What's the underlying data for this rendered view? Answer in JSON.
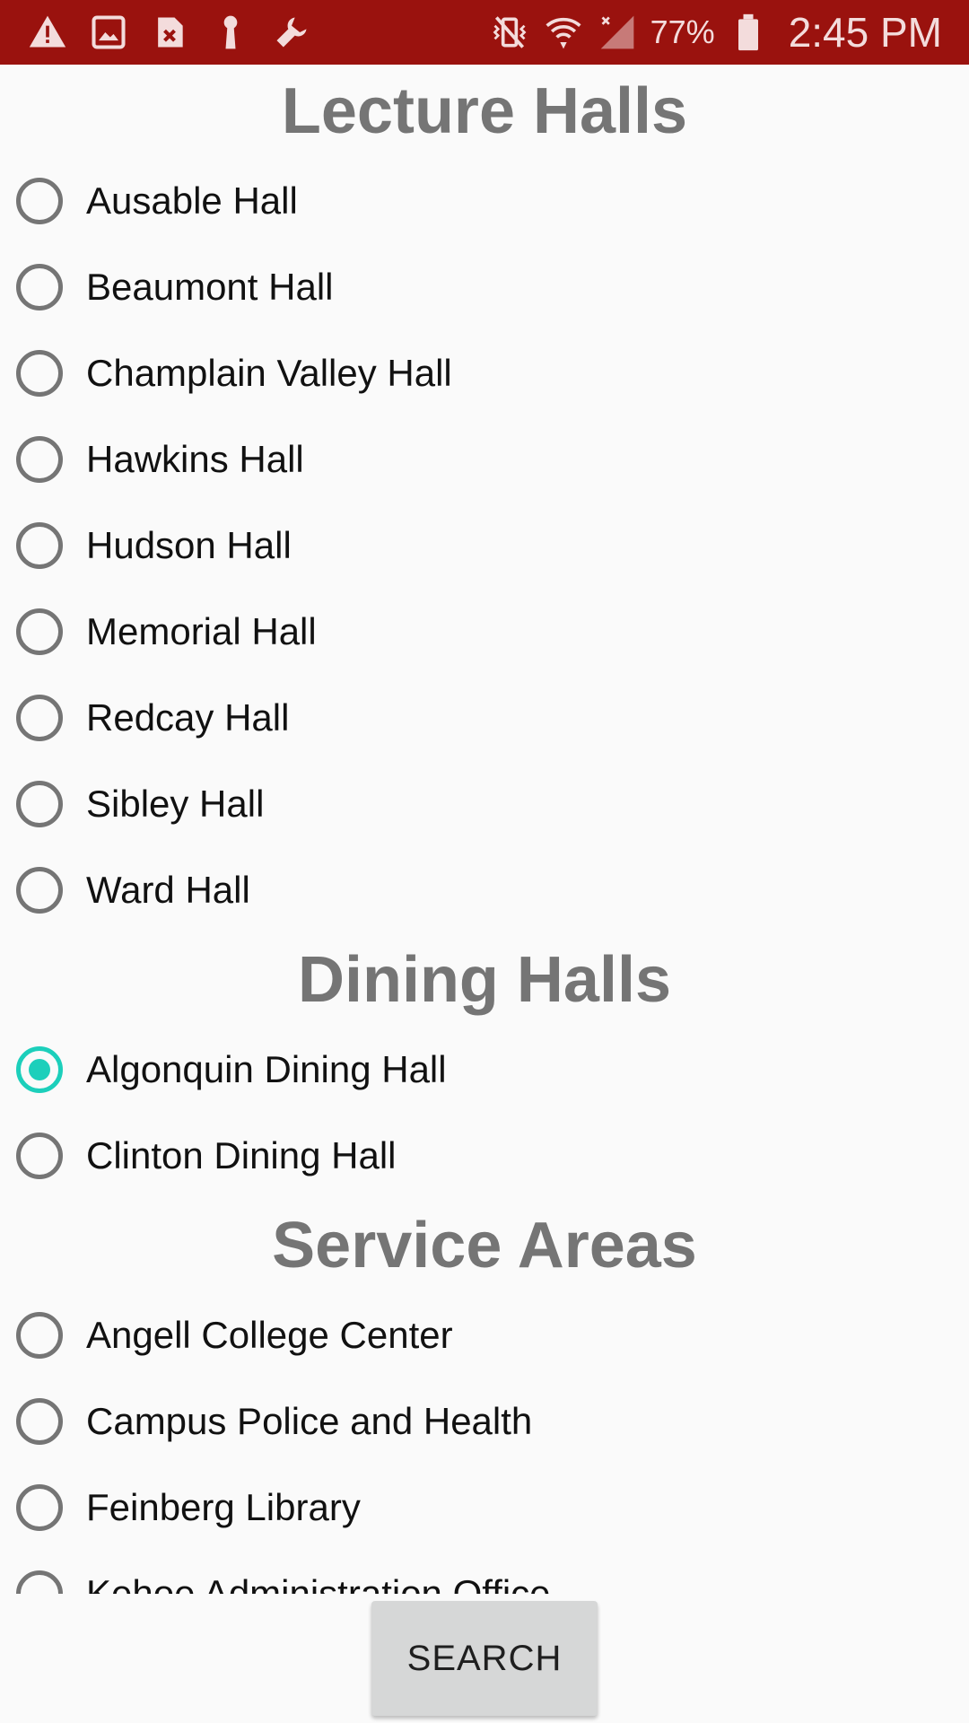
{
  "status_bar": {
    "battery_text": "77%",
    "time": "2:45 PM",
    "icons": [
      "warning-icon",
      "image-icon",
      "sim-error-icon",
      "key-icon",
      "wrench-icon",
      "vibrate-off-icon",
      "wifi-icon",
      "signal-icon",
      "battery-icon"
    ]
  },
  "sections": [
    {
      "title": "Lecture Halls",
      "items": [
        {
          "label": "Ausable Hall",
          "checked": false
        },
        {
          "label": "Beaumont Hall",
          "checked": false
        },
        {
          "label": "Champlain Valley Hall",
          "checked": false
        },
        {
          "label": "Hawkins Hall",
          "checked": false
        },
        {
          "label": "Hudson Hall",
          "checked": false
        },
        {
          "label": "Memorial Hall",
          "checked": false
        },
        {
          "label": "Redcay Hall",
          "checked": false
        },
        {
          "label": "Sibley Hall",
          "checked": false
        },
        {
          "label": "Ward Hall",
          "checked": false
        }
      ]
    },
    {
      "title": "Dining Halls",
      "items": [
        {
          "label": "Algonquin Dining Hall",
          "checked": true
        },
        {
          "label": "Clinton Dining Hall",
          "checked": false
        }
      ]
    },
    {
      "title": "Service Areas",
      "items": [
        {
          "label": "Angell College Center",
          "checked": false
        },
        {
          "label": "Campus Police and Health",
          "checked": false
        },
        {
          "label": "Feinberg Library",
          "checked": false
        },
        {
          "label": "Kehoe Administration Office",
          "checked": false
        }
      ]
    }
  ],
  "search_button": {
    "label": "SEARCH"
  },
  "colors": {
    "status_bar": "#9a120e",
    "accent": "#1ccfbb",
    "title": "#757575"
  }
}
